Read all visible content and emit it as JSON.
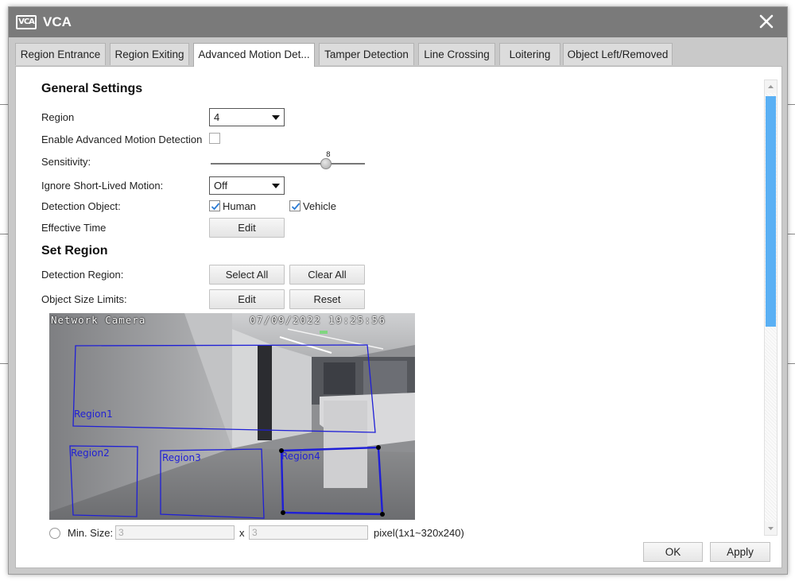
{
  "window": {
    "title": "VCA",
    "logo_text": "VCA"
  },
  "tabs": [
    {
      "label": "Region Entrance"
    },
    {
      "label": "Region Exiting"
    },
    {
      "label": "Advanced Motion Det..."
    },
    {
      "label": "Tamper Detection"
    },
    {
      "label": "Line Crossing"
    },
    {
      "label": "Loitering"
    },
    {
      "label": "Object Left/Removed"
    }
  ],
  "active_tab": "Advanced Motion Det...",
  "general": {
    "heading": "General Settings",
    "region_label": "Region",
    "region_value": "4",
    "enable_label": "Enable Advanced Motion Detection",
    "enable_checked": false,
    "sensitivity_label": "Sensitivity:",
    "sensitivity_value": "8",
    "sensitivity_fraction": 0.8,
    "ignore_label": "Ignore Short-Lived Motion:",
    "ignore_value": "Off",
    "detection_object_label": "Detection Object:",
    "human_label": "Human",
    "human_checked": true,
    "vehicle_label": "Vehicle",
    "vehicle_checked": true,
    "effective_time_label": "Effective Time",
    "edit_label": "Edit"
  },
  "set_region": {
    "heading": "Set Region",
    "detection_region_label": "Detection Region:",
    "select_all_label": "Select All",
    "clear_all_label": "Clear All",
    "object_size_label": "Object Size Limits:",
    "edit_label": "Edit",
    "reset_label": "Reset"
  },
  "camera": {
    "osd_name": "Network Camera",
    "osd_time": "07/09/2022 19:25:56",
    "regions": [
      "Region1",
      "Region2",
      "Region3",
      "Region4"
    ],
    "region_color": "#1f1fd6"
  },
  "min_size": {
    "label": "Min. Size:",
    "width": "3",
    "separator": "x",
    "height": "3",
    "range_hint": "pixel(1x1~320x240)"
  },
  "footer": {
    "ok_label": "OK",
    "apply_label": "Apply"
  },
  "colors": {
    "titlebar": "#7a7a7a",
    "scroll_thumb": "#5ab0f4",
    "accent_check": "#2a7bd4"
  }
}
